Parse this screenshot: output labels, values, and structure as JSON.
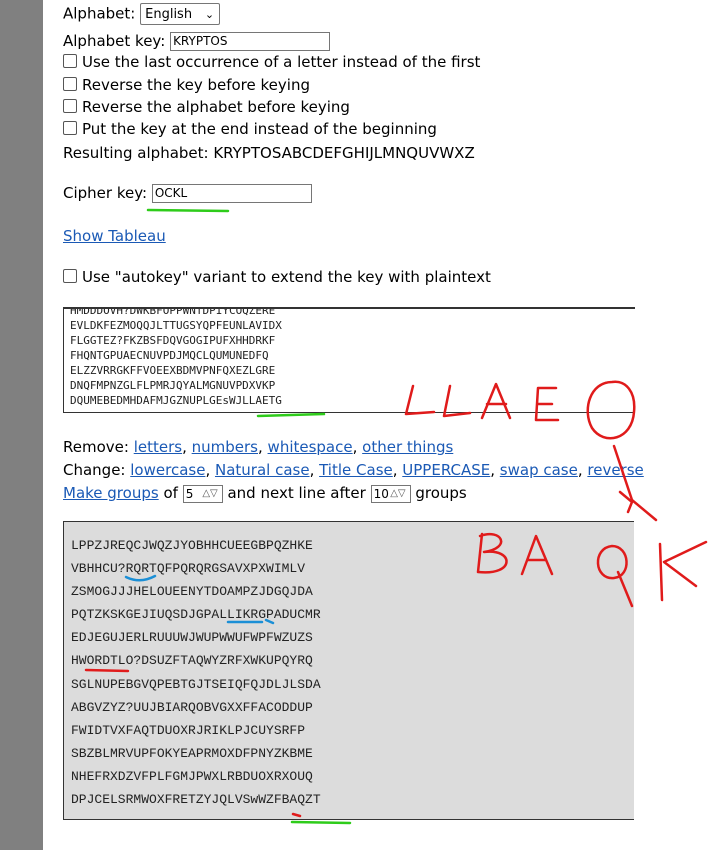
{
  "alphabet": {
    "label": "Alphabet:",
    "selected": "English"
  },
  "alphabet_key": {
    "label": "Alphabet key:",
    "value": "KRYPTOS"
  },
  "options": [
    "Use the last occurrence of a letter instead of the first",
    "Reverse the key before keying",
    "Reverse the alphabet before keying",
    "Put the key at the end instead of the beginning"
  ],
  "resulting_alphabet": "Resulting alphabet: KRYPTOSABCDEFGHIJLMNQUVWXZ",
  "cipher_key": {
    "label": "Cipher key:",
    "value": "OCKL"
  },
  "show_tableau": "Show Tableau",
  "autokey": "Use \"autokey\" variant to extend the key with plaintext",
  "input_lines": [
    "HMDDDOVH?DWKBFOPPWNTDPIYCOQZERE",
    "EVLDKFEZMOQQJLTTUGSYQPFEUNLAVIDX",
    "FLGGTEZ?FKZBSFDQVGOGIPUFXHHDRKF",
    "FHQNTGPUAECNUVPDJMQCLQUMUNEDFQ",
    "ELZZVRRGKFFVOEEXBDMVPNFQXEZLGRE",
    "DNQFMPNZGLFLPMRJQYALMGNUVPDXVKP",
    "DQUMEBEDMHDAFMJGZNUPLGEsWJLLAETG"
  ],
  "remove": {
    "label": "Remove:",
    "links": [
      "letters",
      "numbers",
      "whitespace",
      "other things"
    ]
  },
  "change": {
    "label": "Change:",
    "links": [
      "lowercase",
      "Natural case",
      "Title Case",
      "UPPERCASE",
      "swap case",
      "reverse"
    ]
  },
  "groups": {
    "link": "Make groups",
    "of": "of",
    "size": "5",
    "middle": "and next line after",
    "count": "10",
    "end": "groups"
  },
  "output_lines": [
    "LPPZJREQCJWQZJYOBHHCUEEGBPQZHKE",
    "VBHHCU?RQRTQFPQRQRGSAVXPXWIMLV",
    "ZSMOGJJJHELOUEENYTDOAMPZJDGQJDA",
    "PQTZKSKGEJIUQSDJGPALLIKRGPADUCMR",
    "EDJEGUJERLRUUUWJWUPWWUFWPFWZUZS",
    "HWORDTLO?DSUZFTAQWYZRFXWKUPQYRQ",
    "SGLNUPEBGVQPEBTGJTSEIQFQJDLJLSDA",
    "ABGVZYZ?UUJBIARQOBVGXXFFACODDUP",
    "FWIDTVXFAQTDUOXRJRIKLPJCUYSRFP",
    "SBZBLMRVUPFOKYEAPRMOXDFPNYZKBME",
    "NHEFRXDZVFPLFGMJPWXLRBDUOXRXOUQ",
    "DPJCELSRMWOXFRETZYJQLVSwWZFBAQZT"
  ],
  "colors": {
    "link": "#1a59b5",
    "annotation_red": "#e01b1b",
    "annotation_green": "#2ecc1a",
    "annotation_blue": "#1b8fd6"
  }
}
